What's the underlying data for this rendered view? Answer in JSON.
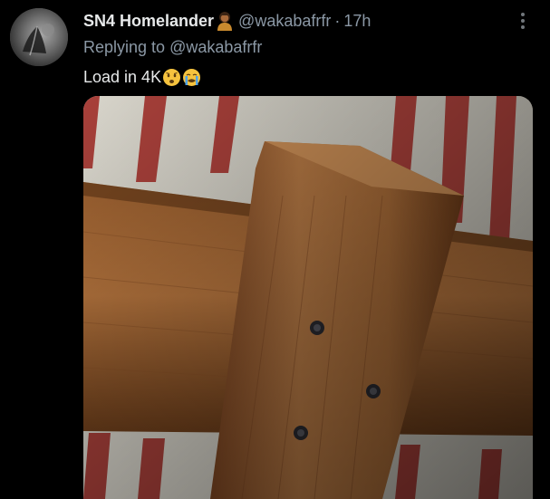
{
  "tweet": {
    "display_name": "SN4 Homelander",
    "name_emoji": "person-emoji",
    "handle": "@wakabafrfr",
    "separator": "·",
    "time": "17h",
    "reply_prefix": "Replying to",
    "reply_handle": "@wakabafrfr",
    "text": "Load in 4K",
    "text_emojis": [
      "worried-face-emoji",
      "loudly-crying-face-emoji"
    ],
    "media": {
      "description_icon": "photo-wooden-beams"
    }
  },
  "colors": {
    "background": "#000000",
    "primary_text": "#e7e9ea",
    "secondary_text": "#8b98a5"
  }
}
